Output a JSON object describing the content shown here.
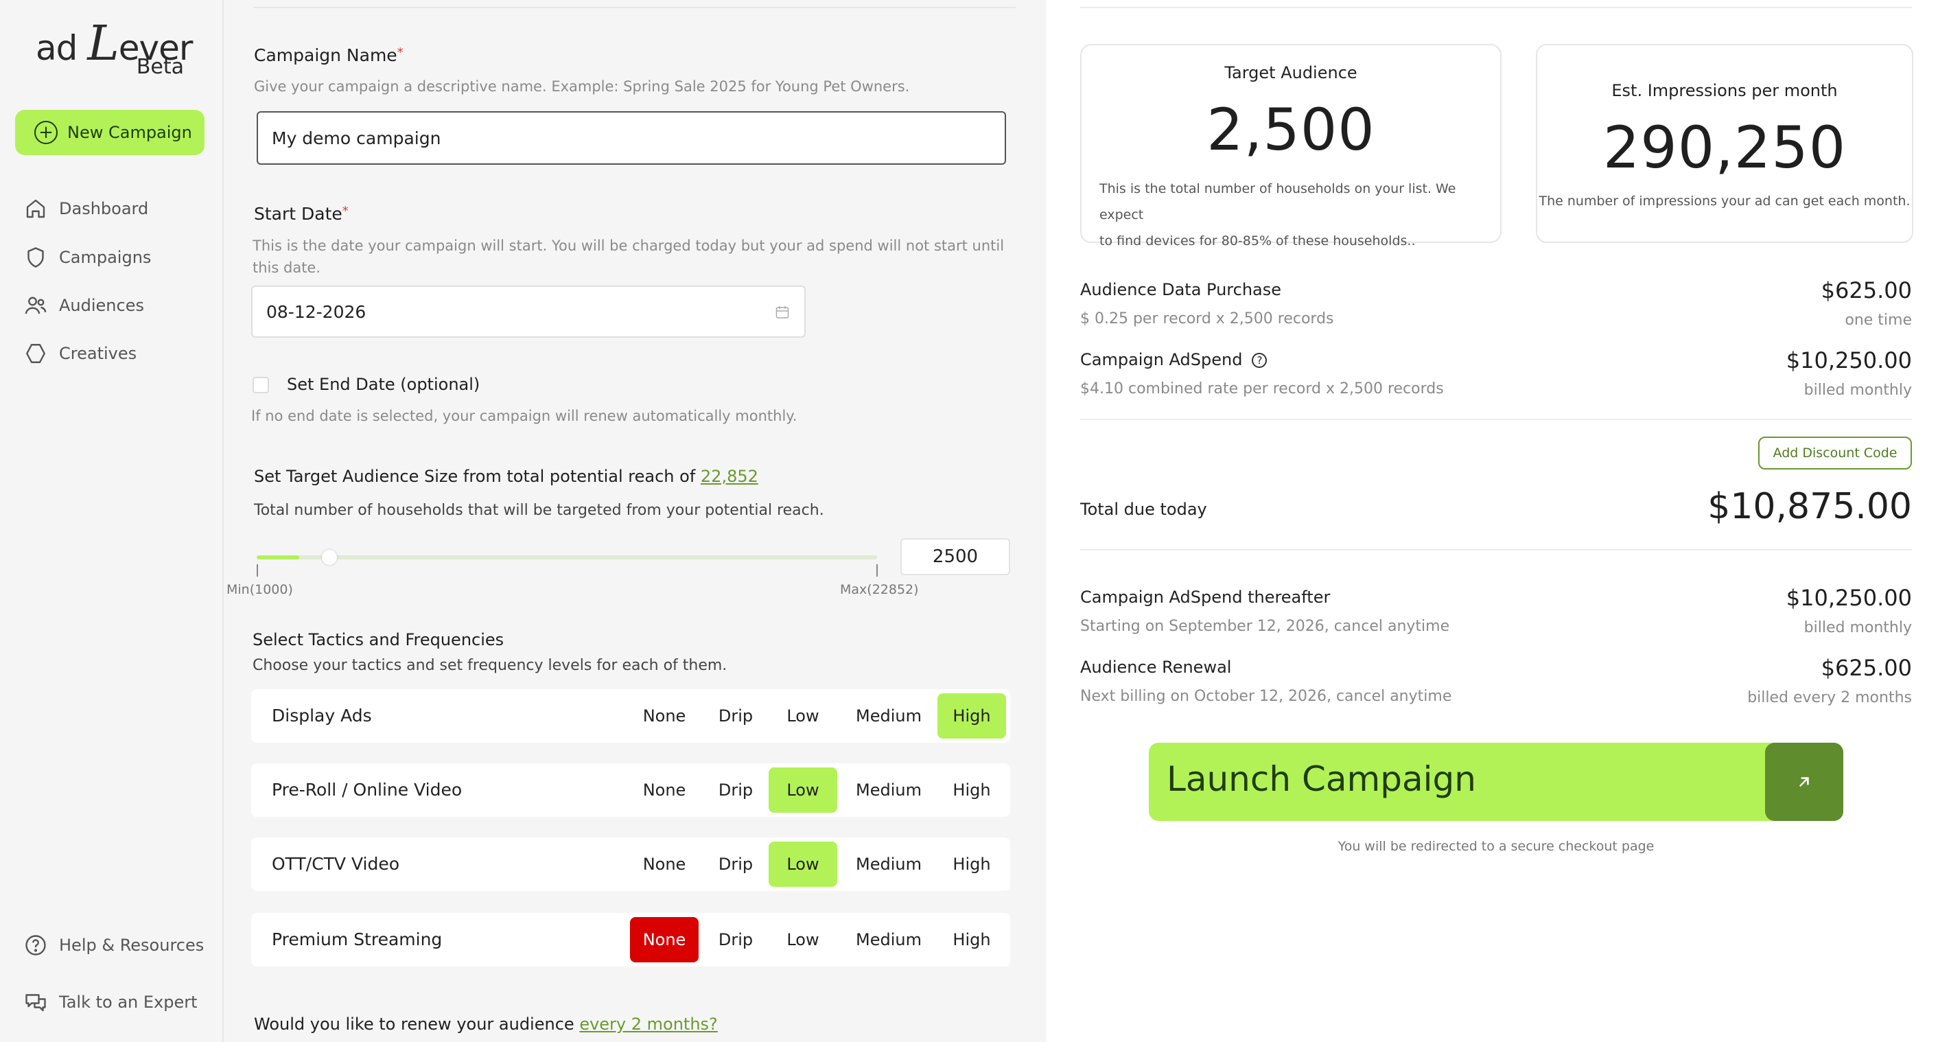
{
  "brand": {
    "logo_prefix": "ad",
    "logo_big": "L",
    "logo_rest": "ever",
    "beta": "Beta"
  },
  "sidebar": {
    "new_campaign": "New Campaign",
    "items": [
      {
        "label": "Dashboard",
        "icon": "home-icon"
      },
      {
        "label": "Campaigns",
        "icon": "shield-icon"
      },
      {
        "label": "Audiences",
        "icon": "users-icon"
      },
      {
        "label": "Creatives",
        "icon": "hexagon-icon"
      }
    ],
    "footer": [
      {
        "label": "Help & Resources",
        "icon": "help-icon"
      },
      {
        "label": "Talk to an Expert",
        "icon": "chat-icon"
      }
    ]
  },
  "form": {
    "campaign_name": {
      "label": "Campaign Name",
      "required": "*",
      "help": "Give your campaign a descriptive name. Example: Spring Sale 2025 for Young Pet Owners.",
      "value": "My demo campaign"
    },
    "start_date": {
      "label": "Start Date",
      "required": "*",
      "help": "This is the date your campaign will start. You will be charged today but your ad spend will not start until this date.",
      "value": "08-12-2026"
    },
    "end_date": {
      "label": "Set End Date (optional)",
      "help": "If no end date is selected, your campaign will renew automatically monthly."
    },
    "audience": {
      "label": "Set Target Audience Size from total potential reach of",
      "reach": "22,852",
      "help": "Total number of households that will be targeted from your potential reach.",
      "min_label": "Min(1000)",
      "max_label": "Max(22852)",
      "min": 1000,
      "max": 22852,
      "value": 2500,
      "value_text": "2500"
    },
    "tactics": {
      "label": "Select Tactics and Frequencies",
      "help": "Choose your tactics and set frequency levels for each of them.",
      "levels": [
        "None",
        "Drip",
        "Low",
        "Medium",
        "High"
      ],
      "rows": [
        {
          "name": "Display Ads",
          "selected": "High"
        },
        {
          "name": "Pre-Roll / Online Video",
          "selected": "Low"
        },
        {
          "name": "OTT/CTV Video",
          "selected": "Low"
        },
        {
          "name": "Premium Streaming",
          "selected": "None"
        }
      ]
    },
    "renew": {
      "label": "Would you like to renew your audience",
      "link": "every 2 months?"
    }
  },
  "summary": {
    "target_card": {
      "title": "Target Audience",
      "value": "2,500",
      "desc_line1": "This is the total number of households on your list. We expect",
      "desc_line2": "to find devices for 80-85% of these households.."
    },
    "impressions_card": {
      "title": "Est. Impressions per month",
      "value": "290,250",
      "desc": "The number of impressions your ad can get each month."
    },
    "audience_purchase": {
      "label": "Audience Data Purchase",
      "sub": "$ 0.25 per record x 2,500 records",
      "amount": "$625.00",
      "amount_sub": "one time"
    },
    "adspend": {
      "label": "Campaign AdSpend",
      "sub": "$4.10 combined rate per record x 2,500 records",
      "amount": "$10,250.00",
      "amount_sub": "billed monthly"
    },
    "discount": "Add Discount Code",
    "total": {
      "label": "Total due today",
      "amount": "$10,875.00"
    },
    "thereafter": {
      "label": "Campaign AdSpend thereafter",
      "sub": "Starting on September 12, 2026, cancel anytime",
      "amount": "$10,250.00",
      "amount_sub": "billed monthly"
    },
    "renewal": {
      "label": "Audience Renewal",
      "sub": "Next billing on October 12, 2026, cancel anytime",
      "amount": "$625.00",
      "amount_sub": "billed every 2 months"
    },
    "launch": "Launch Campaign",
    "redirect": "You will be redirected to a secure checkout page"
  },
  "colors": {
    "accent": "#b2f257",
    "accent_dark": "#5f8c2c",
    "link": "#6b9a2d",
    "danger": "#d90000"
  }
}
